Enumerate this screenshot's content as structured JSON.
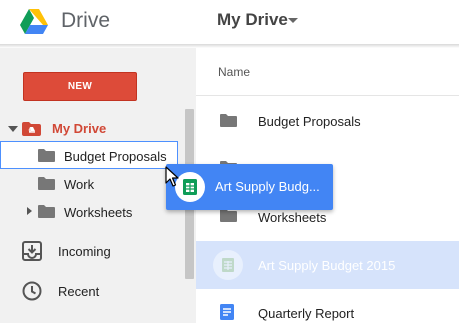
{
  "app": {
    "name": "Drive",
    "logo_icon": "google-drive-logo"
  },
  "header": {
    "breadcrumb": "My Drive",
    "breadcrumb_icon": "caret-down-icon"
  },
  "sidebar": {
    "new_button": "NEW",
    "my_drive": {
      "label": "My Drive",
      "expanded": true,
      "color": "#d14836"
    },
    "tree": [
      {
        "label": "Budget Proposals",
        "drop_target": true
      },
      {
        "label": "Work"
      },
      {
        "label": "Worksheets",
        "has_children": true
      }
    ],
    "nav": [
      {
        "label": "Incoming",
        "icon": "incoming-icon"
      },
      {
        "label": "Recent",
        "icon": "clock-icon"
      }
    ]
  },
  "main": {
    "column_header": "Name",
    "files": [
      {
        "name": "Budget Proposals",
        "icon": "folder-icon"
      },
      {
        "name": "",
        "icon": "folder-icon"
      },
      {
        "name": "Worksheets",
        "icon": "folder-icon"
      },
      {
        "name": "Art Supply Budget 2015",
        "icon": "sheets-icon",
        "selected": true
      },
      {
        "name": "Quarterly Report",
        "icon": "docs-icon"
      }
    ]
  },
  "drag": {
    "label": "Art Supply Budg...",
    "icon": "sheets-icon",
    "color": "#4285f4"
  },
  "colors": {
    "new_button": "#dd4b39",
    "selection": "#d6e3fb",
    "drop_outline": "#4d90fe",
    "sheets_green": "#0f9d58",
    "docs_blue": "#4285f4"
  }
}
